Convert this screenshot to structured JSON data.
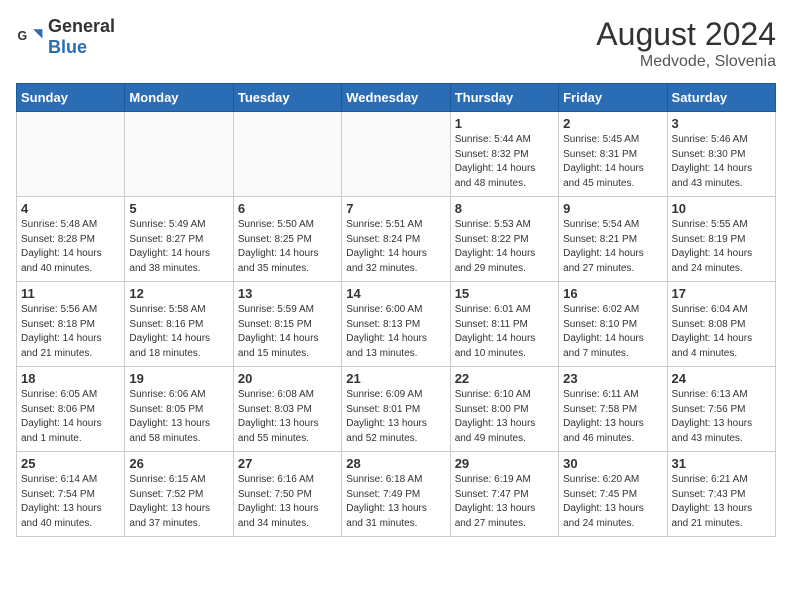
{
  "header": {
    "logo_general": "General",
    "logo_blue": "Blue",
    "month_year": "August 2024",
    "location": "Medvode, Slovenia"
  },
  "days_of_week": [
    "Sunday",
    "Monday",
    "Tuesday",
    "Wednesday",
    "Thursday",
    "Friday",
    "Saturday"
  ],
  "weeks": [
    [
      {
        "day": "",
        "info": ""
      },
      {
        "day": "",
        "info": ""
      },
      {
        "day": "",
        "info": ""
      },
      {
        "day": "",
        "info": ""
      },
      {
        "day": "1",
        "info": "Sunrise: 5:44 AM\nSunset: 8:32 PM\nDaylight: 14 hours\nand 48 minutes."
      },
      {
        "day": "2",
        "info": "Sunrise: 5:45 AM\nSunset: 8:31 PM\nDaylight: 14 hours\nand 45 minutes."
      },
      {
        "day": "3",
        "info": "Sunrise: 5:46 AM\nSunset: 8:30 PM\nDaylight: 14 hours\nand 43 minutes."
      }
    ],
    [
      {
        "day": "4",
        "info": "Sunrise: 5:48 AM\nSunset: 8:28 PM\nDaylight: 14 hours\nand 40 minutes."
      },
      {
        "day": "5",
        "info": "Sunrise: 5:49 AM\nSunset: 8:27 PM\nDaylight: 14 hours\nand 38 minutes."
      },
      {
        "day": "6",
        "info": "Sunrise: 5:50 AM\nSunset: 8:25 PM\nDaylight: 14 hours\nand 35 minutes."
      },
      {
        "day": "7",
        "info": "Sunrise: 5:51 AM\nSunset: 8:24 PM\nDaylight: 14 hours\nand 32 minutes."
      },
      {
        "day": "8",
        "info": "Sunrise: 5:53 AM\nSunset: 8:22 PM\nDaylight: 14 hours\nand 29 minutes."
      },
      {
        "day": "9",
        "info": "Sunrise: 5:54 AM\nSunset: 8:21 PM\nDaylight: 14 hours\nand 27 minutes."
      },
      {
        "day": "10",
        "info": "Sunrise: 5:55 AM\nSunset: 8:19 PM\nDaylight: 14 hours\nand 24 minutes."
      }
    ],
    [
      {
        "day": "11",
        "info": "Sunrise: 5:56 AM\nSunset: 8:18 PM\nDaylight: 14 hours\nand 21 minutes."
      },
      {
        "day": "12",
        "info": "Sunrise: 5:58 AM\nSunset: 8:16 PM\nDaylight: 14 hours\nand 18 minutes."
      },
      {
        "day": "13",
        "info": "Sunrise: 5:59 AM\nSunset: 8:15 PM\nDaylight: 14 hours\nand 15 minutes."
      },
      {
        "day": "14",
        "info": "Sunrise: 6:00 AM\nSunset: 8:13 PM\nDaylight: 14 hours\nand 13 minutes."
      },
      {
        "day": "15",
        "info": "Sunrise: 6:01 AM\nSunset: 8:11 PM\nDaylight: 14 hours\nand 10 minutes."
      },
      {
        "day": "16",
        "info": "Sunrise: 6:02 AM\nSunset: 8:10 PM\nDaylight: 14 hours\nand 7 minutes."
      },
      {
        "day": "17",
        "info": "Sunrise: 6:04 AM\nSunset: 8:08 PM\nDaylight: 14 hours\nand 4 minutes."
      }
    ],
    [
      {
        "day": "18",
        "info": "Sunrise: 6:05 AM\nSunset: 8:06 PM\nDaylight: 14 hours\nand 1 minute."
      },
      {
        "day": "19",
        "info": "Sunrise: 6:06 AM\nSunset: 8:05 PM\nDaylight: 13 hours\nand 58 minutes."
      },
      {
        "day": "20",
        "info": "Sunrise: 6:08 AM\nSunset: 8:03 PM\nDaylight: 13 hours\nand 55 minutes."
      },
      {
        "day": "21",
        "info": "Sunrise: 6:09 AM\nSunset: 8:01 PM\nDaylight: 13 hours\nand 52 minutes."
      },
      {
        "day": "22",
        "info": "Sunrise: 6:10 AM\nSunset: 8:00 PM\nDaylight: 13 hours\nand 49 minutes."
      },
      {
        "day": "23",
        "info": "Sunrise: 6:11 AM\nSunset: 7:58 PM\nDaylight: 13 hours\nand 46 minutes."
      },
      {
        "day": "24",
        "info": "Sunrise: 6:13 AM\nSunset: 7:56 PM\nDaylight: 13 hours\nand 43 minutes."
      }
    ],
    [
      {
        "day": "25",
        "info": "Sunrise: 6:14 AM\nSunset: 7:54 PM\nDaylight: 13 hours\nand 40 minutes."
      },
      {
        "day": "26",
        "info": "Sunrise: 6:15 AM\nSunset: 7:52 PM\nDaylight: 13 hours\nand 37 minutes."
      },
      {
        "day": "27",
        "info": "Sunrise: 6:16 AM\nSunset: 7:50 PM\nDaylight: 13 hours\nand 34 minutes."
      },
      {
        "day": "28",
        "info": "Sunrise: 6:18 AM\nSunset: 7:49 PM\nDaylight: 13 hours\nand 31 minutes."
      },
      {
        "day": "29",
        "info": "Sunrise: 6:19 AM\nSunset: 7:47 PM\nDaylight: 13 hours\nand 27 minutes."
      },
      {
        "day": "30",
        "info": "Sunrise: 6:20 AM\nSunset: 7:45 PM\nDaylight: 13 hours\nand 24 minutes."
      },
      {
        "day": "31",
        "info": "Sunrise: 6:21 AM\nSunset: 7:43 PM\nDaylight: 13 hours\nand 21 minutes."
      }
    ]
  ]
}
